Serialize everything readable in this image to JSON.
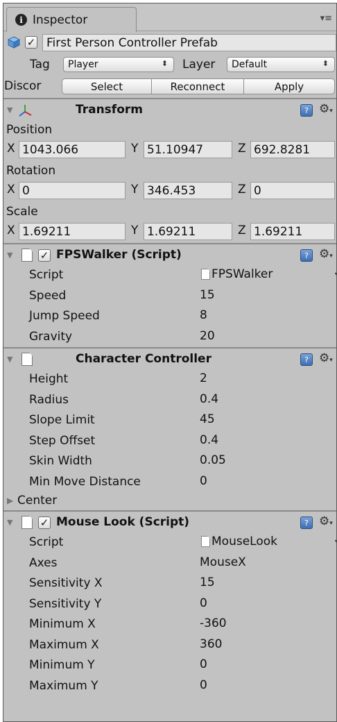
{
  "tab": {
    "label": "Inspector"
  },
  "object": {
    "name": "First Person Controller Prefab",
    "active": true
  },
  "tag": {
    "label": "Tag",
    "value": "Player"
  },
  "layer": {
    "label": "Layer",
    "value": "Default"
  },
  "prefab": {
    "status": "Discor",
    "select": "Select",
    "reconnect": "Reconnect",
    "apply": "Apply"
  },
  "transform": {
    "title": "Transform",
    "position": {
      "label": "Position",
      "x": "1043.066",
      "y": "51.10947",
      "z": "692.8281"
    },
    "rotation": {
      "label": "Rotation",
      "x": "0",
      "y": "346.453",
      "z": "0"
    },
    "scale": {
      "label": "Scale",
      "x": "1.69211",
      "y": "1.69211",
      "z": "1.69211"
    },
    "axes": {
      "x": "X",
      "y": "Y",
      "z": "Z"
    }
  },
  "fps": {
    "title": "FPSWalker (Script)",
    "props": [
      {
        "label": "Script",
        "value": "FPSWalker"
      },
      {
        "label": "Speed",
        "value": "15"
      },
      {
        "label": "Jump Speed",
        "value": "8"
      },
      {
        "label": "Gravity",
        "value": "20"
      }
    ]
  },
  "cc": {
    "title": "Character Controller",
    "props": [
      {
        "label": "Height",
        "value": "2"
      },
      {
        "label": "Radius",
        "value": "0.4"
      },
      {
        "label": "Slope Limit",
        "value": "45"
      },
      {
        "label": "Step Offset",
        "value": "0.4"
      },
      {
        "label": "Skin Width",
        "value": "0.05"
      },
      {
        "label": "Min Move Distance",
        "value": "0"
      }
    ],
    "center": "Center"
  },
  "mouse": {
    "title": "Mouse Look (Script)",
    "props": [
      {
        "label": "Script",
        "value": "MouseLook"
      },
      {
        "label": "Axes",
        "value": "MouseX"
      },
      {
        "label": "Sensitivity X",
        "value": "15"
      },
      {
        "label": "Sensitivity Y",
        "value": "0"
      },
      {
        "label": "Minimum X",
        "value": "-360"
      },
      {
        "label": "Maximum X",
        "value": "360"
      },
      {
        "label": "Minimum Y",
        "value": "0"
      },
      {
        "label": "Maximum Y",
        "value": "0"
      }
    ]
  }
}
